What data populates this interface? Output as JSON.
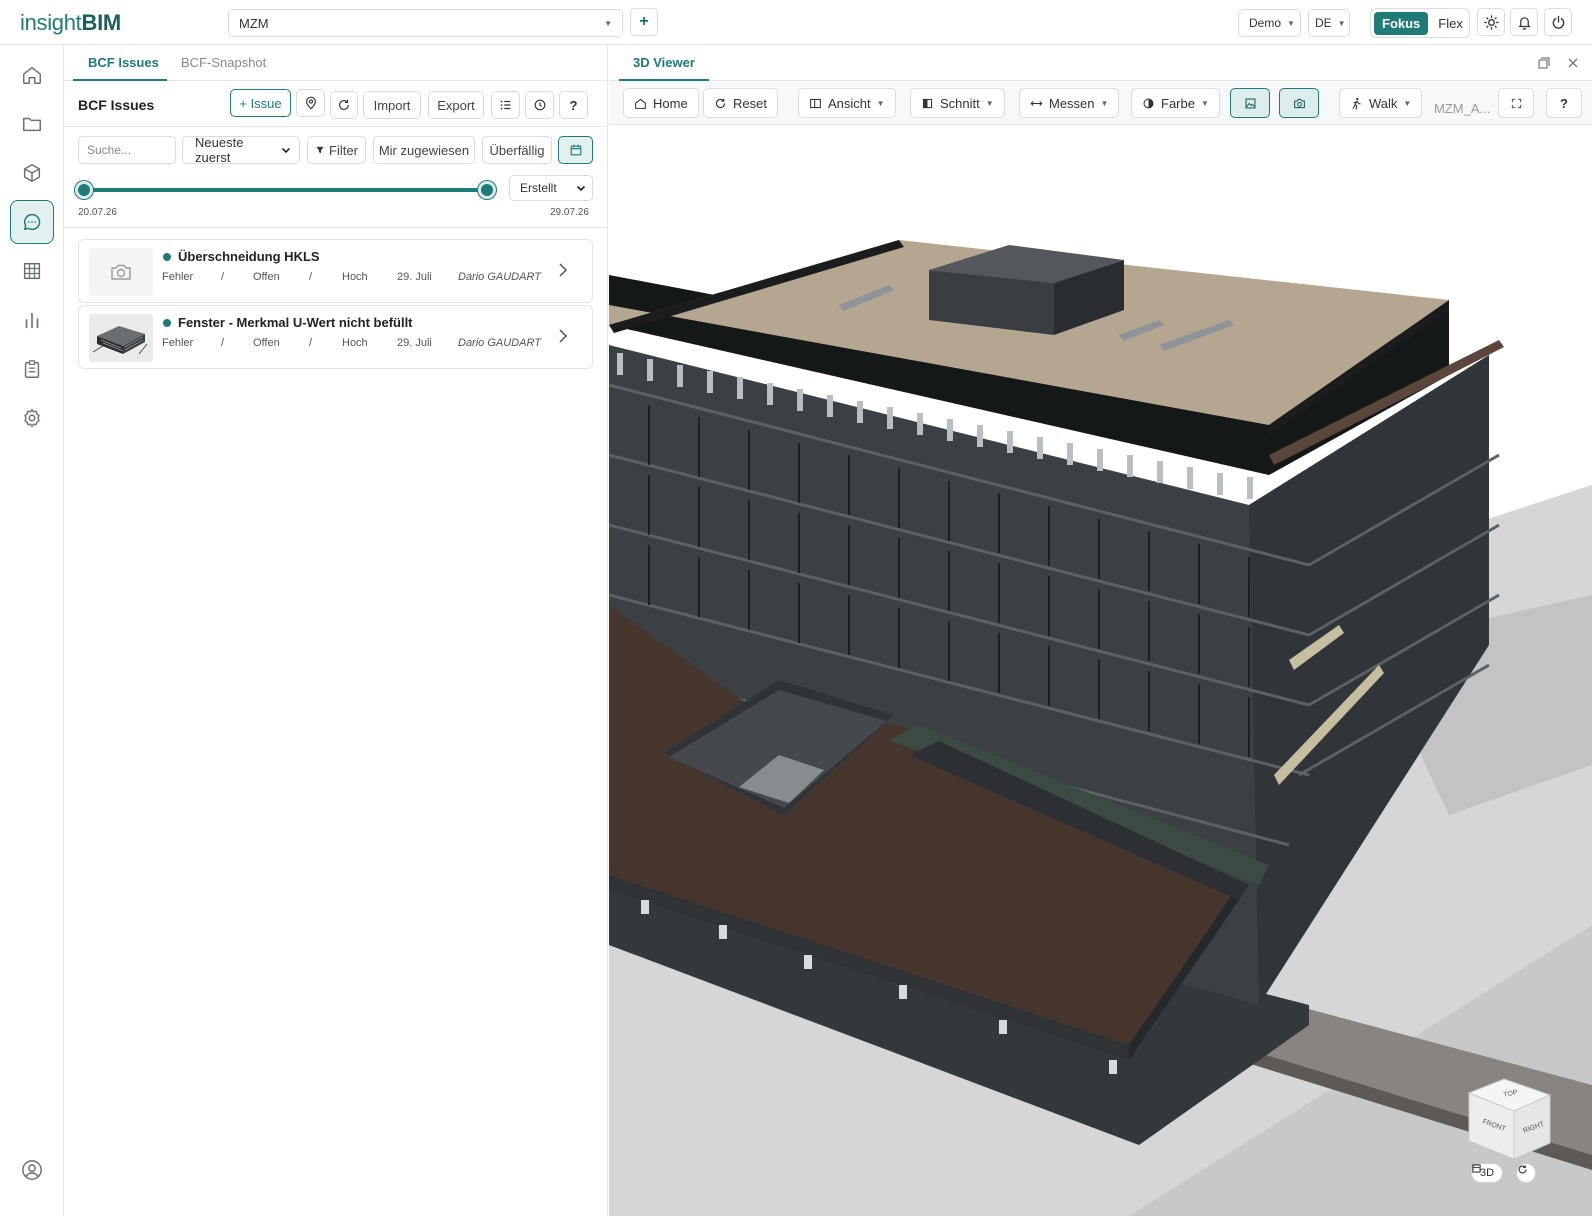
{
  "app": {
    "logo_part1": "insight",
    "logo_part2": "BIM"
  },
  "topbar": {
    "project_value": "MZM",
    "add_label": "+",
    "workspace_value": "Demo",
    "language_value": "DE",
    "mode_active": "Fokus",
    "mode_inactive": "Flex"
  },
  "bcf": {
    "tabs": [
      "BCF Issues",
      "BCF-Snapshot"
    ],
    "title": "BCF Issues",
    "add_issue_label": "+ Issue",
    "import_label": "Import",
    "export_label": "Export",
    "help_label": "?",
    "search_placeholder": "Suche...",
    "sort_value": "Neueste zuerst",
    "filter_label": "Filter",
    "assigned_label": "Mir zugewiesen",
    "overdue_label": "Überfällig",
    "date_mode_value": "Erstellt",
    "date_start": "20.07.26",
    "date_end": "29.07.26",
    "range_start_fraction": 0,
    "range_end_fraction": 1,
    "issues": [
      {
        "title": "Überschneidung HKLS",
        "type": "Fehler",
        "status": "Offen",
        "priority": "Hoch",
        "date": "29. Juli",
        "author": "Dario GAUDART",
        "separator": "/"
      },
      {
        "title": "Fenster - Merkmal U-Wert nicht befüllt",
        "type": "Fehler",
        "status": "Offen",
        "priority": "Hoch",
        "date": "29. Juli",
        "author": "Dario GAUDART",
        "separator": "/"
      }
    ]
  },
  "viewer": {
    "tab_label": "3D Viewer",
    "toolbar": {
      "home": "Home",
      "reset": "Reset",
      "view": "Ansicht",
      "section": "Schnitt",
      "measure": "Messen",
      "color": "Farbe",
      "walk": "Walk",
      "model_name": "MZM_A...",
      "help": "?"
    },
    "view_badge": "3D"
  },
  "colors": {
    "accent": "#1f7a78",
    "accent_light": "#e2f0ef"
  }
}
